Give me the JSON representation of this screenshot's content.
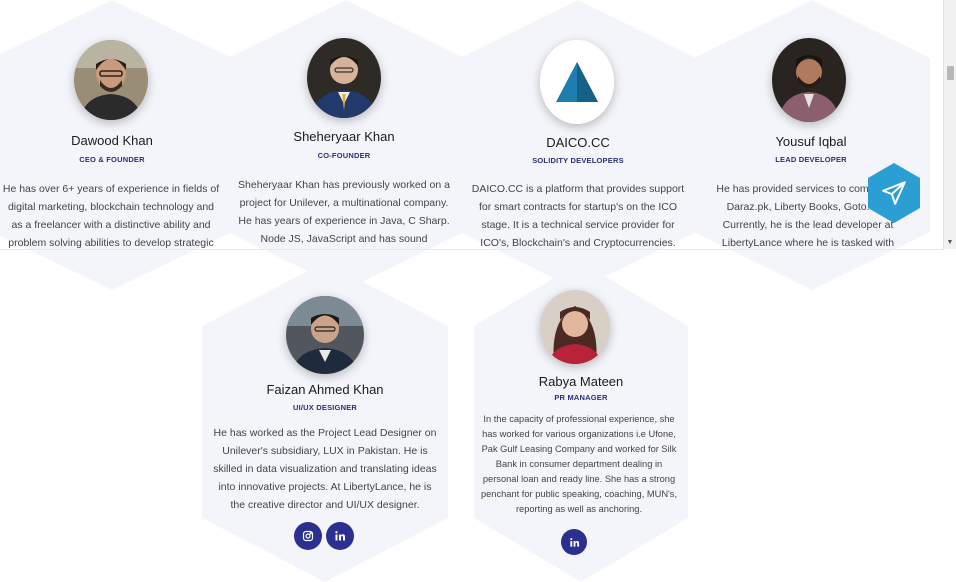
{
  "team_top": [
    {
      "name": "Dawood Khan",
      "role": "CEO & FOUNDER",
      "bio": "He has over 6+ years of experience in fields of digital marketing, blockchain technology and as a freelancer with a distinctive ability and problem solving abilities to develop strategic plans that"
    },
    {
      "name": "Sheheryaar Khan",
      "role": "CO-FOUNDER",
      "bio": "Sheheryaar Khan has previously worked on a project for Unilever, a multinational company. He has years of experience in Java, C Sharp. Node JS, JavaScript and has sound knowledge of the"
    },
    {
      "name": "DAICO.CC",
      "role": "SOLIDITY DEVELOPERS",
      "bio": "DAICO.CC is a platform that provides support for smart contracts for startup's on the ICO stage. It is a technical service provider for ICO's, Blockchain's and Cryptocurrencies."
    },
    {
      "name": "Yousuf Iqbal",
      "role": "LEAD DEVELOPER",
      "bio": "He has provided services to companies Daraz.pk, Liberty Books, Goto.com Currently, he is the lead developer at LibertyLance where he is tasked with unifying"
    }
  ],
  "team_bottom": [
    {
      "name": "Faizan Ahmed Khan",
      "role": "UI/UX DESIGNER",
      "bio": "He has worked as the Project Lead Designer on Unilever's subsidiary, LUX in Pakistan. He is skilled in data visualization and translating ideas into innovative projects. At LibertyLance, he is the creative director and UI/UX designer.",
      "socials": [
        "instagram-icon",
        "linkedin-icon"
      ]
    },
    {
      "name": "Rabya Mateen",
      "role": "PR MANAGER",
      "bio": "In the capacity of professional experience, she has worked for various organizations i.e Ufone, Pak Gulf Leasing Company and worked for Silk Bank in consumer department dealing in personal loan and ready line. She has a strong penchant for public speaking, coaching, MUN's, reporting as well as anchoring.",
      "socials": [
        "linkedin-icon"
      ]
    }
  ],
  "colors": {
    "accent": "#2b2f8f",
    "fab": "#2b9fd4",
    "daico_logo": "#1d7fb0",
    "card_bg": "#f4f5fa"
  },
  "fab_icon": "send-icon"
}
